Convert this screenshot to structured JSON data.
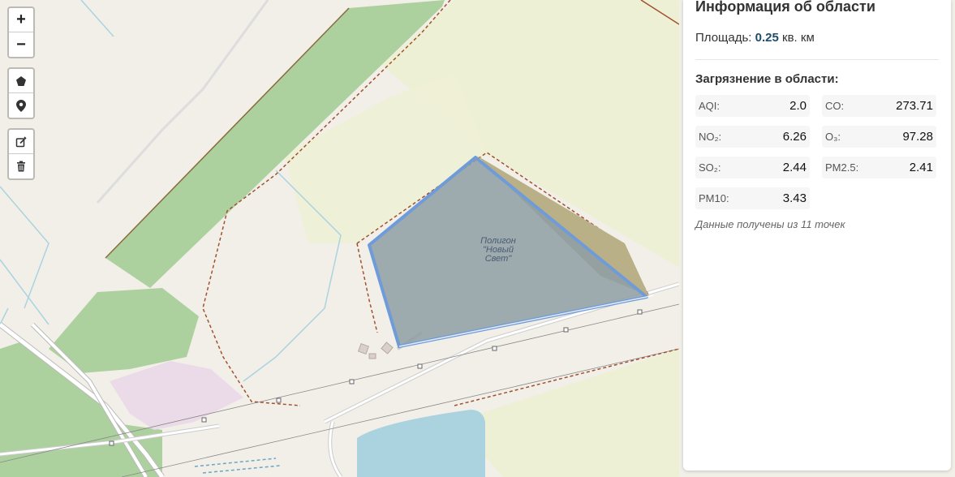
{
  "map": {
    "controls": {
      "zoom_in": "+",
      "zoom_out": "−"
    },
    "polygon_label_lines": [
      "Полигон",
      "\"Новый",
      "Свет\""
    ],
    "colors": {
      "forest": "#add19e",
      "farmland": "#eef0d5",
      "water": "#aad3df",
      "polygon_fill": "#8e9fa4",
      "polygon_stroke": "#6f9bd8",
      "boundary": "#a0522d",
      "industrial": "#ebdbe8"
    }
  },
  "panel": {
    "title": "Информация об области",
    "area_label": "Площадь:",
    "area_value": "0.25",
    "area_unit": "кв. км",
    "pollution_title": "Загрязнение в области:",
    "metrics": [
      {
        "name": "AQI:",
        "value": "2.0"
      },
      {
        "name": "CO:",
        "value": "273.71"
      },
      {
        "name": "NO₂:",
        "value": "6.26"
      },
      {
        "name": "O₃:",
        "value": "97.28"
      },
      {
        "name": "SO₂:",
        "value": "2.44"
      },
      {
        "name": "PM2.5:",
        "value": "2.41"
      },
      {
        "name": "PM10:",
        "value": "3.43"
      }
    ],
    "source_note": "Данные получены из 11 точек"
  }
}
